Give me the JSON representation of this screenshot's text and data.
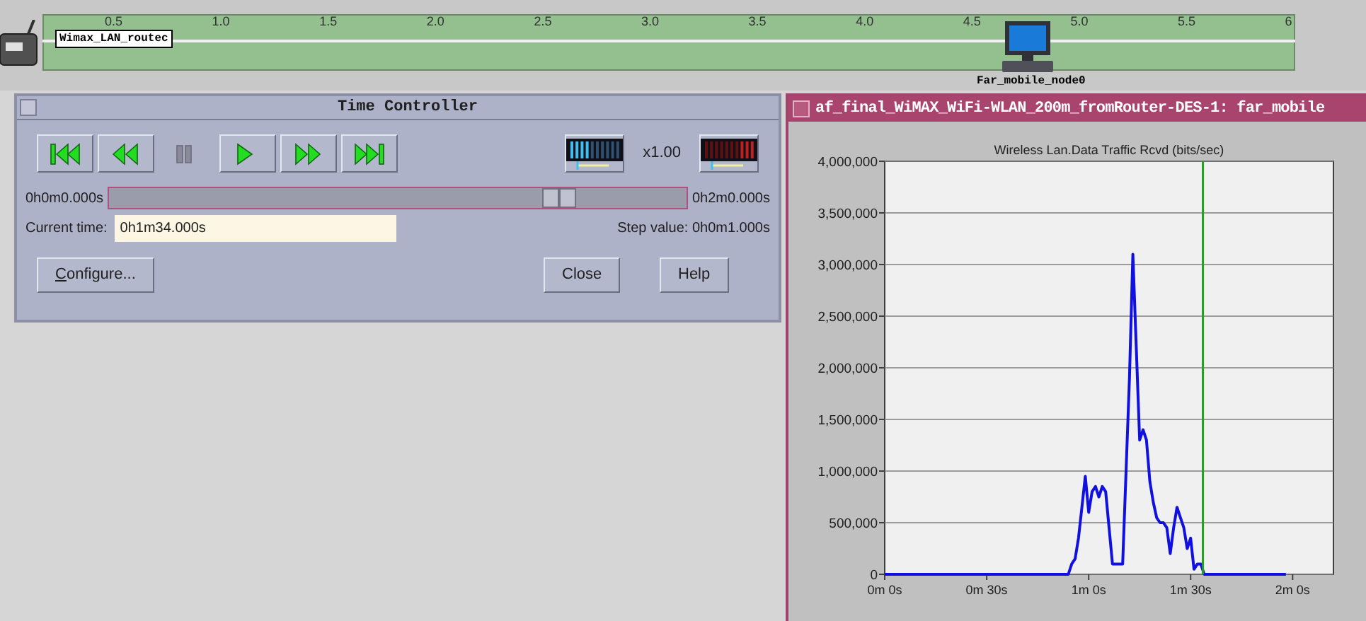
{
  "timeline": {
    "ticks": [
      "0.5",
      "1.0",
      "1.5",
      "2.0",
      "2.5",
      "3.0",
      "3.5",
      "4.0",
      "4.5",
      "5.0",
      "5.5",
      "6"
    ],
    "nodes": [
      {
        "kind": "router",
        "label": "Wimax_LAN_routec"
      },
      {
        "kind": "computer",
        "label": "Far_mobile_node0"
      }
    ]
  },
  "time_controller": {
    "title": "Time Controller",
    "transport": [
      {
        "kind": "first",
        "disabled": false
      },
      {
        "kind": "rewind",
        "disabled": false
      },
      {
        "kind": "pause",
        "disabled": true
      },
      {
        "kind": "play",
        "disabled": false
      },
      {
        "kind": "forward",
        "disabled": false
      },
      {
        "kind": "last",
        "disabled": false
      }
    ],
    "speed": "x1.00",
    "start": "0h0m0.000s",
    "end": "0h2m0.000s",
    "level": 0.78,
    "current_time_label": "Current time:",
    "current_time": "0h1m34.000s",
    "step_label": "Step value:",
    "step_value": "0h0m1.000s",
    "buttons": [
      {
        "label": "Configure..."
      },
      {
        "label": "Close"
      },
      {
        "label": "Help"
      }
    ]
  },
  "graph_window": {
    "title": "af_final_WiMAX_WiFi-WLAN_200m_fromRouter-DES-1: far_mobile",
    "chart_data": {
      "type": "line",
      "title": "Wireless Lan.Data Traffic Rcvd (bits/sec)",
      "categories": [
        "0m 0s",
        null,
        null,
        null,
        null,
        null,
        null,
        null,
        null,
        null,
        null,
        null,
        null,
        null,
        null,
        null,
        null,
        null,
        null,
        null,
        null,
        null,
        null,
        null,
        null,
        null,
        null,
        null,
        null,
        null,
        "0m 30s",
        null,
        null,
        null,
        null,
        null,
        null,
        null,
        null,
        null,
        null,
        null,
        null,
        null,
        null,
        null,
        null,
        null,
        null,
        null,
        null,
        null,
        null,
        null,
        null,
        null,
        null,
        null,
        null,
        null,
        "1m 0s",
        null,
        null,
        null,
        null,
        null,
        null,
        null,
        null,
        null,
        null,
        null,
        null,
        null,
        null,
        null,
        null,
        null,
        null,
        null,
        null,
        null,
        null,
        null,
        null,
        null,
        null,
        null,
        null,
        null,
        "1m 30s",
        null,
        null,
        null,
        null,
        null,
        null,
        null,
        null,
        null,
        null,
        null,
        null,
        null,
        null,
        null,
        null,
        null,
        null,
        null,
        null,
        null,
        null,
        null,
        null,
        null,
        null,
        null,
        null,
        null,
        "2m 0s",
        null,
        null,
        null,
        null,
        null,
        null,
        null,
        null,
        null,
        null,
        null,
        null
      ],
      "series": [
        {
          "color": "#1010e0",
          "values": [
            0,
            0,
            0,
            0,
            0,
            0,
            0,
            0,
            0,
            0,
            0,
            0,
            0,
            0,
            0,
            0,
            0,
            0,
            0,
            0,
            0,
            0,
            0,
            0,
            0,
            0,
            0,
            0,
            0,
            0,
            0,
            0,
            0,
            0,
            0,
            0,
            0,
            0,
            0,
            0,
            0,
            0,
            0,
            0,
            0,
            0,
            0,
            0,
            0,
            0,
            0,
            0,
            0,
            0,
            0,
            100000,
            150000,
            350000,
            650000,
            950000,
            600000,
            800000,
            850000,
            750000,
            850000,
            800000,
            450000,
            100000,
            100000,
            100000,
            100000,
            1000000,
            1900000,
            3100000,
            2200000,
            1300000,
            1400000,
            1300000,
            900000,
            700000,
            550000,
            500000,
            500000,
            450000,
            200000,
            450000,
            650000,
            550000,
            450000,
            250000,
            350000,
            50000,
            100000,
            100000,
            0,
            0,
            0,
            0,
            0,
            0,
            0,
            0,
            0,
            0,
            0,
            0,
            0,
            0,
            0,
            0,
            0,
            0,
            0,
            0,
            0,
            0,
            0,
            0,
            0,
            null,
            null,
            null,
            null,
            null,
            null,
            null,
            null,
            null,
            null,
            null,
            null,
            null,
            null
          ]
        }
      ],
      "grid": true,
      "ylim": [
        0,
        4000000
      ],
      "yticks": [
        {
          "value": 0,
          "label": "0"
        },
        {
          "value": 500000,
          "label": "500,000"
        },
        {
          "value": 1000000,
          "label": "1,000,000"
        },
        {
          "value": 1500000,
          "label": "1,500,000"
        },
        {
          "value": 2000000,
          "label": "2,000,000"
        },
        {
          "value": 2500000,
          "label": "2,500,000"
        },
        {
          "value": 3000000,
          "label": "3,000,000"
        },
        {
          "value": 3500000,
          "label": "3,500,000"
        },
        {
          "value": 4000000,
          "label": "4,000,000"
        }
      ]
    }
  }
}
